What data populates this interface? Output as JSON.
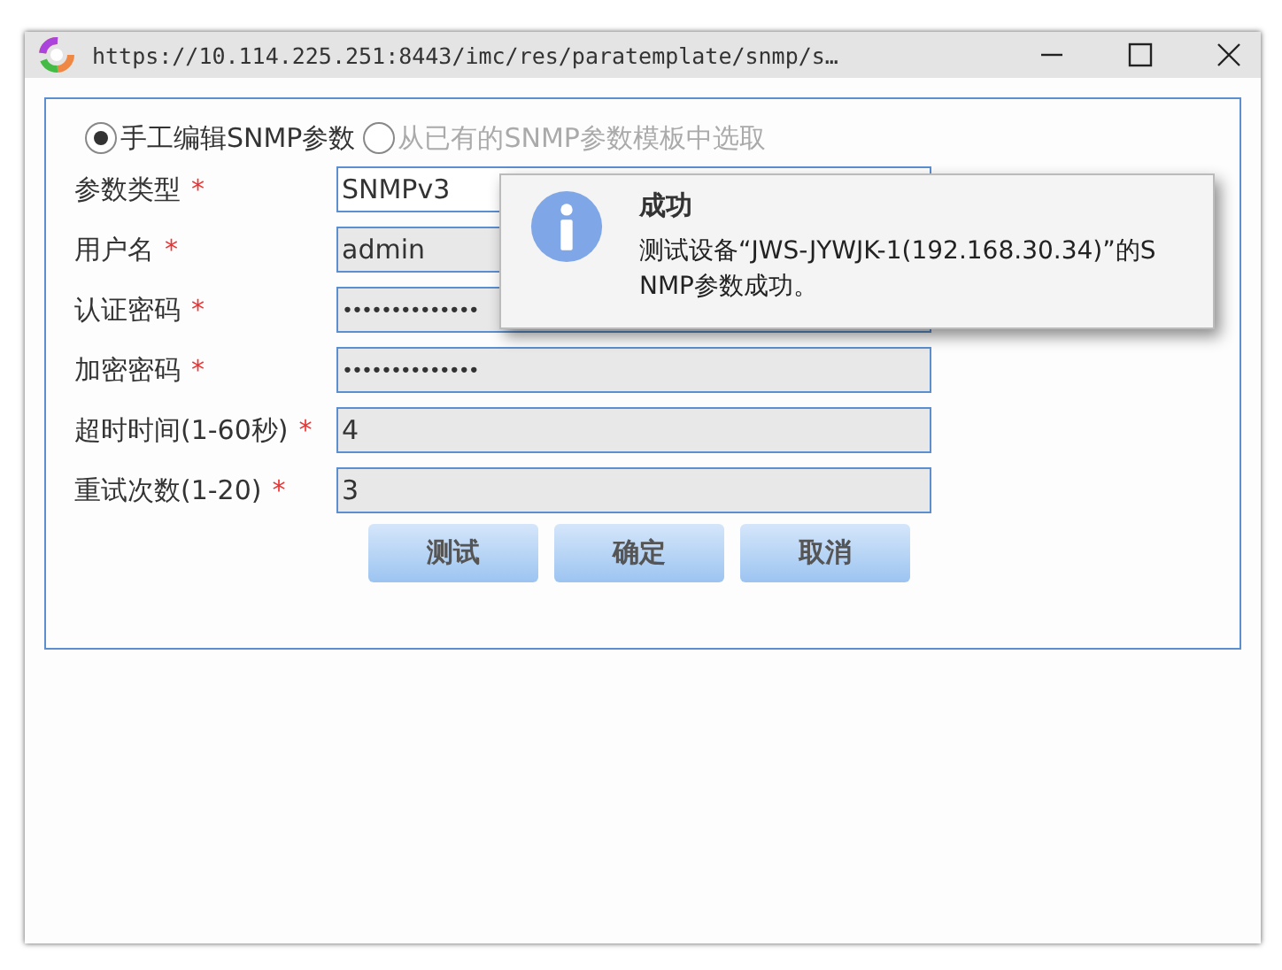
{
  "window": {
    "title": "https://10.114.225.251:8443/imc/res/paratemplate/snmp/s…"
  },
  "required_mark": "*",
  "mode_options": [
    {
      "label": "手工编辑SNMP参数",
      "selected": true
    },
    {
      "label": "从已有的SNMP参数模板中选取",
      "selected": false
    }
  ],
  "fields": [
    {
      "label": "参数类型",
      "required": true,
      "value": "SNMPv3",
      "kind": "select"
    },
    {
      "label": "用户名",
      "required": true,
      "value": "admin",
      "kind": "text"
    },
    {
      "label": "认证密码",
      "required": true,
      "value": "••••••••••••••",
      "kind": "password"
    },
    {
      "label": "加密密码",
      "required": true,
      "value": "••••••••••••••",
      "kind": "password"
    },
    {
      "label": "超时时间(1-60秒)",
      "required": true,
      "value": "4",
      "kind": "text"
    },
    {
      "label": "重试次数(1-20)",
      "required": true,
      "value": "3",
      "kind": "text"
    }
  ],
  "buttons": [
    "测试",
    "确定",
    "取消"
  ],
  "message": {
    "title": "成功",
    "text": "测试设备“JWS-JYWJK-1(192.168.30.34)”的SNMP参数成功。"
  }
}
